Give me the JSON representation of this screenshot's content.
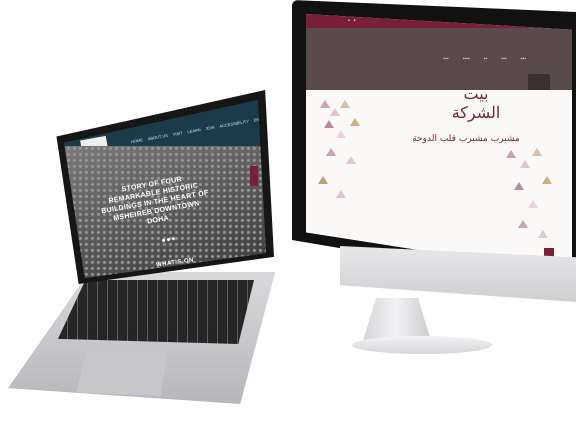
{
  "laptop": {
    "headline": "STORY OF FOUR REMARKABLE HISTORIC BUILDINGS IN THE HEART OF MSHEIREB DOWNTOWN DOHA",
    "section_label": "WHAT'S ON",
    "nav_items": [
      "HOME",
      "ABOUT US",
      "VISIT",
      "LEARN",
      "JOIN",
      "ACCESSIBILITY",
      "EN"
    ]
  },
  "imac": {
    "title_ar": "بيت الشركة",
    "subtitle_ar": "مشيرب مشيرب\nقلب الدوحة"
  },
  "colors": {
    "accent": "#7a1f3a",
    "laptop_nav": "#1b3a4a",
    "imac_nav": "#5a4a4c"
  }
}
